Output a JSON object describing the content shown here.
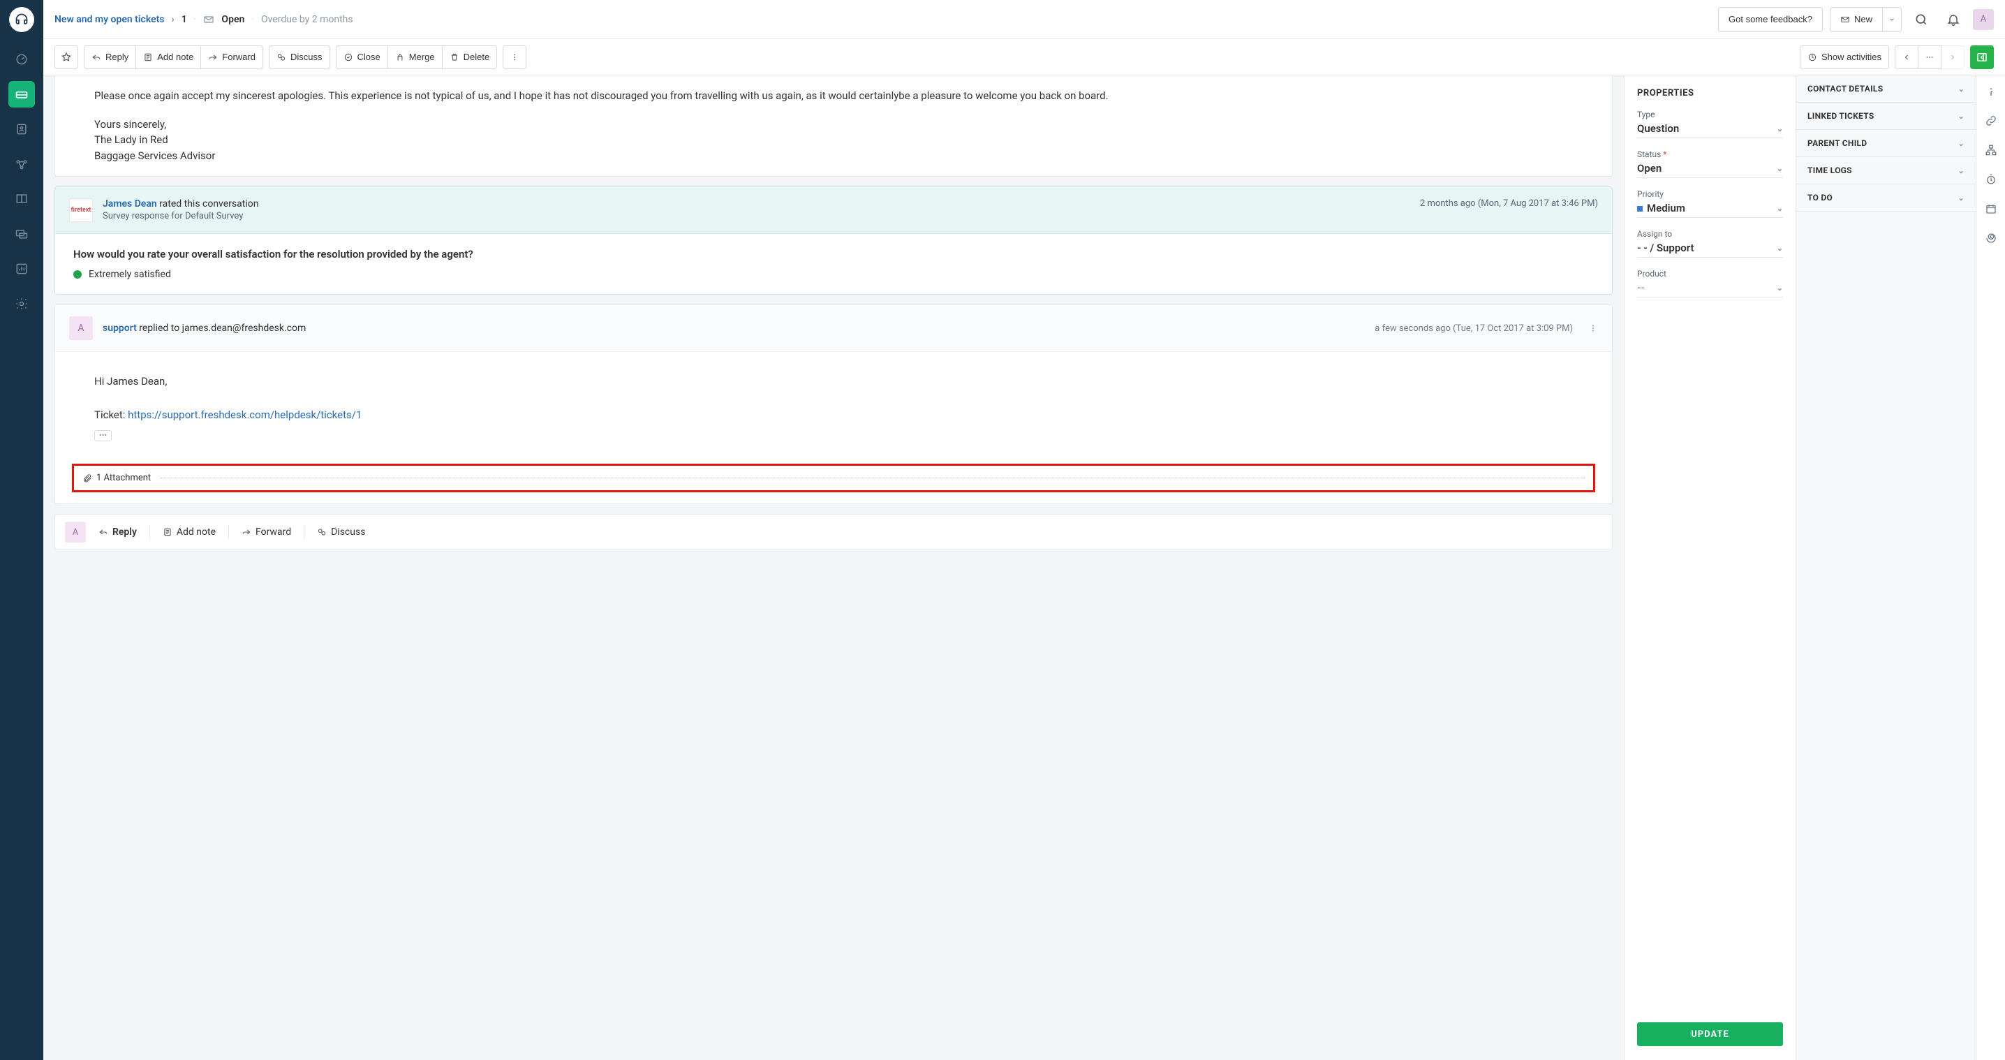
{
  "topbar": {
    "breadcrumb": "New and my open tickets",
    "ticket_number": "1",
    "status_label": "Open",
    "overdue_text": "Overdue by 2 months",
    "feedback_btn": "Got some feedback?",
    "new_btn": "New",
    "avatar_letter": "A"
  },
  "actionbar": {
    "reply": "Reply",
    "add_note": "Add note",
    "forward": "Forward",
    "discuss": "Discuss",
    "close": "Close",
    "merge": "Merge",
    "delete": "Delete",
    "show_activities": "Show activities"
  },
  "message": {
    "p1": "Please once again accept my sincerest apologies. This experience is not typical of us, and I hope it has not discouraged you from travelling with us again, as it would certainlybe a pleasure to welcome you back on board.",
    "sig1": "Yours sincerely,",
    "sig2": "The Lady in Red",
    "sig3": "Baggage Services Advisor"
  },
  "survey": {
    "avatar_text": "firetext",
    "name": "James Dean",
    "rated_text": " rated this conversation",
    "sub": "Survey response for Default Survey",
    "time": "2 months ago (Mon, 7 Aug 2017 at 3:46 PM)",
    "question": "How would you rate your overall satisfaction for the resolution provided by the agent?",
    "answer": "Extremely satisfied"
  },
  "reply": {
    "avatar_letter": "A",
    "name": "support",
    "replied_to_label": " replied to ",
    "to": "james.dean@freshdesk.com",
    "time": "a few seconds ago (Tue, 17 Oct 2017 at 3:09 PM)",
    "greeting": "Hi James Dean,",
    "ticket_label": "Ticket: ",
    "ticket_url": "https://support.freshdesk.com/helpdesk/tickets/1",
    "attachment_label": "1 Attachment"
  },
  "reply_bar": {
    "avatar_letter": "A",
    "reply": "Reply",
    "add_note": "Add note",
    "forward": "Forward",
    "discuss": "Discuss"
  },
  "properties": {
    "title": "PROPERTIES",
    "type_label": "Type",
    "type_value": "Question",
    "status_label": "Status",
    "status_value": "Open",
    "priority_label": "Priority",
    "priority_value": "Medium",
    "assign_label": "Assign to",
    "assign_value": "- - / Support",
    "product_label": "Product",
    "product_value": "--",
    "update_btn": "UPDATE"
  },
  "details": {
    "contact": "CONTACT DETAILS",
    "linked": "LINKED TICKETS",
    "parent": "PARENT CHILD",
    "timelogs": "TIME LOGS",
    "todo": "TO DO"
  }
}
